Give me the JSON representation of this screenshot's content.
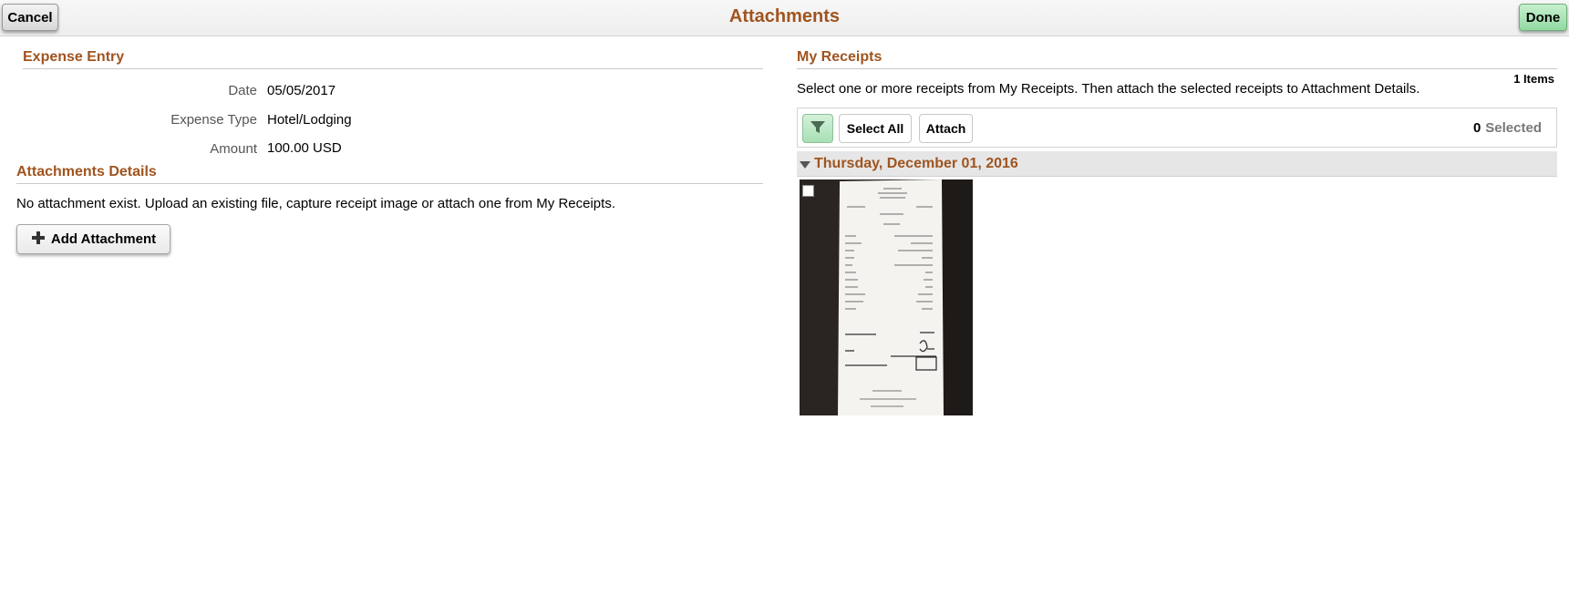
{
  "header": {
    "cancel_label": "Cancel",
    "title": "Attachments",
    "done_label": "Done"
  },
  "expense_entry": {
    "title": "Expense Entry",
    "fields": [
      {
        "label": "Date",
        "value": "05/05/2017"
      },
      {
        "label": "Expense Type",
        "value": "Hotel/Lodging"
      },
      {
        "label": "Amount",
        "value": "100.00 USD"
      }
    ]
  },
  "attachments_details": {
    "title": "Attachments Details",
    "message": "No attachment exist. Upload an existing file, capture receipt image or attach one from My Receipts.",
    "add_label": "Add Attachment",
    "add_icon": "plus-icon"
  },
  "my_receipts": {
    "title": "My Receipts",
    "items_count": "1 Items",
    "instructions": "Select one or more receipts from My Receipts.  Then attach the selected receipts to Attachment Details.",
    "filter_icon": "filter-icon",
    "select_all_label": "Select All",
    "attach_label": "Attach",
    "selected_count": "0",
    "selected_label": "Selected",
    "groups": [
      {
        "date": "Thursday, December 01, 2016",
        "receipts": [
          {
            "checked": false
          }
        ]
      }
    ]
  },
  "colors": {
    "section_title": "#a0541f",
    "done_button": "#92d9a3",
    "filter_button": "#a8e0b5"
  }
}
